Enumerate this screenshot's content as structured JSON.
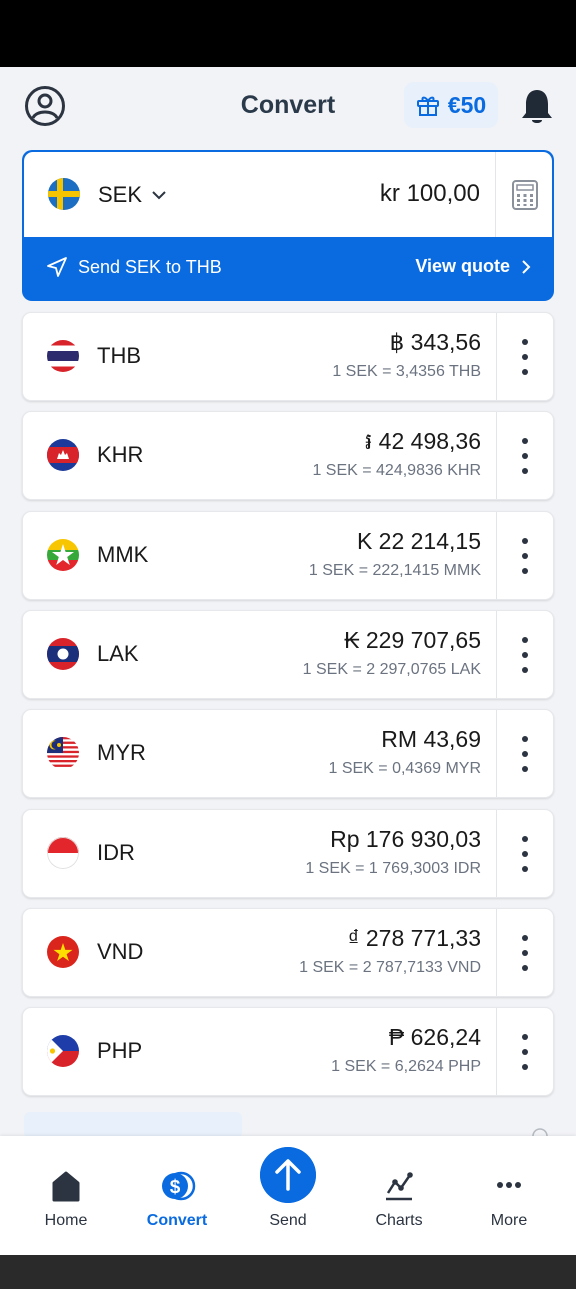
{
  "header": {
    "title": "Convert",
    "reward": "€50"
  },
  "base": {
    "code": "SEK",
    "amount": "kr 100,00",
    "send_label": "Send SEK to THB",
    "quote_label": "View quote"
  },
  "rows": [
    {
      "code": "THB",
      "amount": "฿ 343,56",
      "rate": "1 SEK = 3,4356 THB"
    },
    {
      "code": "KHR",
      "amount": "៛ 42 498,36",
      "rate": "1 SEK = 424,9836 KHR"
    },
    {
      "code": "MMK",
      "amount": "K 22 214,15",
      "rate": "1 SEK = 222,1415 MMK"
    },
    {
      "code": "LAK",
      "amount": "₭ 229 707,65",
      "rate": "1 SEK = 2 297,0765 LAK"
    },
    {
      "code": "MYR",
      "amount": "RM 43,69",
      "rate": "1 SEK = 0,4369 MYR"
    },
    {
      "code": "IDR",
      "amount": "Rp 176 930,03",
      "rate": "1 SEK = 1 769,3003 IDR"
    },
    {
      "code": "VND",
      "amount": "₫ 278 771,33",
      "rate": "1 SEK = 2 787,7133 VND"
    },
    {
      "code": "PHP",
      "amount": "₱ 626,24",
      "rate": "1 SEK = 6,2624 PHP"
    }
  ],
  "nav": {
    "home": "Home",
    "convert": "Convert",
    "send": "Send",
    "charts": "Charts",
    "more": "More"
  },
  "colors": {
    "accent": "#0a6be0",
    "background": "#f2f3f6"
  },
  "icons": [
    "profile-icon",
    "gift-icon",
    "bell-icon",
    "calculator-icon",
    "send-icon",
    "kebab-icon",
    "home-icon",
    "convert-icon",
    "arrow-up-icon",
    "charts-icon",
    "more-icon"
  ]
}
